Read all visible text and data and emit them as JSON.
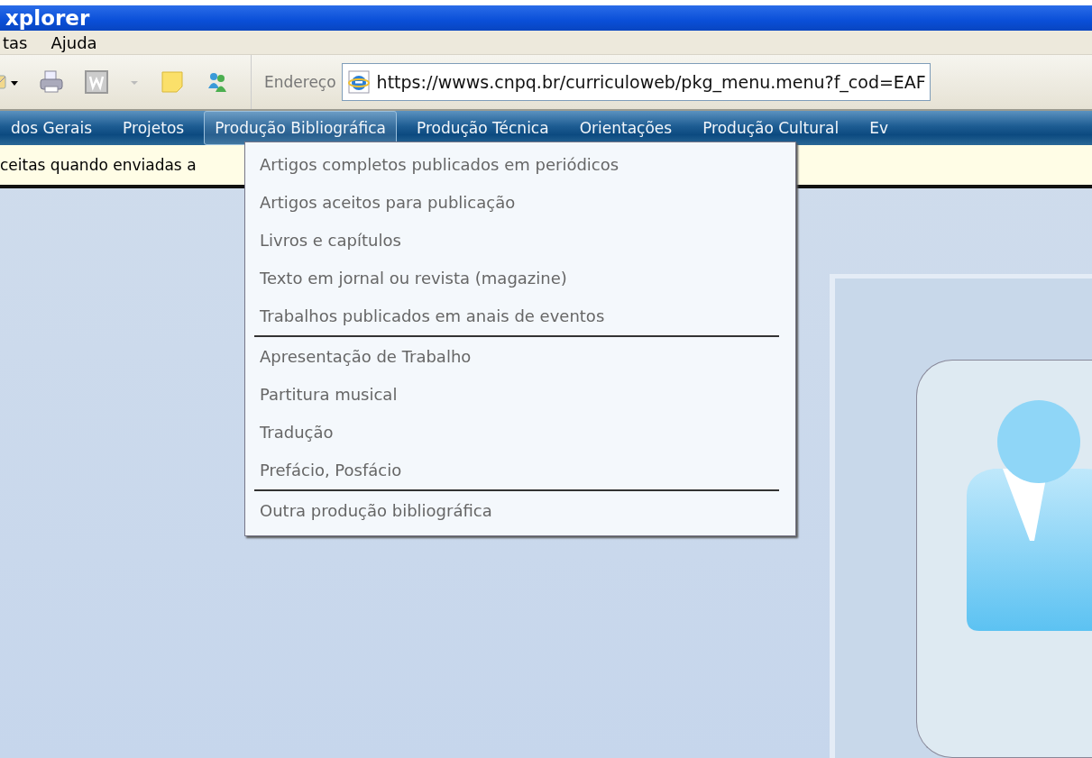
{
  "window": {
    "title": "xplorer"
  },
  "menu_bar": [
    "tas",
    "Ajuda"
  ],
  "address": {
    "label": "Endereço",
    "value": "https://wwws.cnpq.br/curriculoweb/pkg_menu.menu?f_cod=EAF"
  },
  "nav": [
    {
      "label": "dos Gerais",
      "selected": false
    },
    {
      "label": "Projetos",
      "selected": false
    },
    {
      "label": "Produção Bibliográfica",
      "selected": true
    },
    {
      "label": "Produção Técnica",
      "selected": false
    },
    {
      "label": "Orientações",
      "selected": false
    },
    {
      "label": "Produção Cultural",
      "selected": false
    },
    {
      "label": "Ev",
      "selected": false
    }
  ],
  "notice": "ceitas quando enviadas a",
  "dropdown": {
    "groups": [
      [
        "Artigos completos publicados em periódicos",
        "Artigos aceitos para publicação",
        "Livros e capítulos",
        "Texto em jornal ou revista (magazine)",
        "Trabalhos publicados em anais de eventos"
      ],
      [
        "Apresentação de Trabalho",
        "Partitura musical",
        "Tradução",
        "Prefácio, Posfácio"
      ],
      [
        "Outra produção bibliográfica"
      ]
    ]
  }
}
